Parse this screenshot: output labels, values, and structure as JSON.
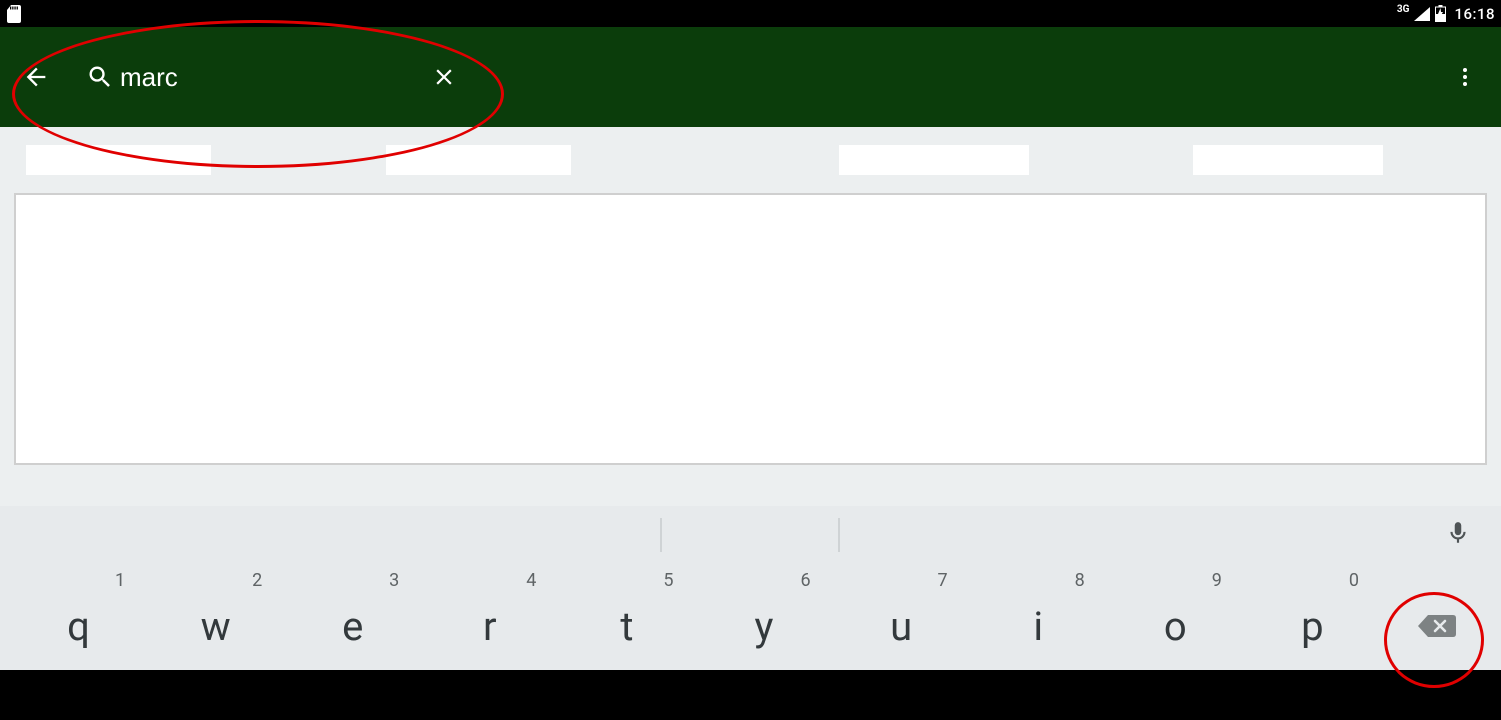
{
  "status": {
    "network": "3G",
    "time": "16:18"
  },
  "appbar": {
    "search_value": "marc"
  },
  "keyboard": {
    "row1": [
      {
        "num": "1",
        "letter": "q"
      },
      {
        "num": "2",
        "letter": "w"
      },
      {
        "num": "3",
        "letter": "e"
      },
      {
        "num": "4",
        "letter": "r"
      },
      {
        "num": "5",
        "letter": "t"
      },
      {
        "num": "6",
        "letter": "y"
      },
      {
        "num": "7",
        "letter": "u"
      },
      {
        "num": "8",
        "letter": "i"
      },
      {
        "num": "9",
        "letter": "o"
      },
      {
        "num": "0",
        "letter": "p"
      }
    ]
  }
}
